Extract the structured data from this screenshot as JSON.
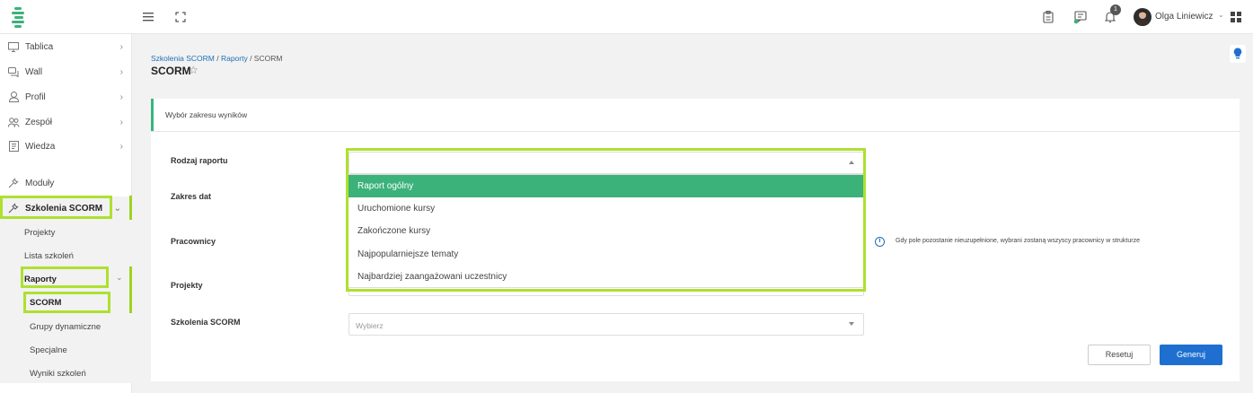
{
  "header": {
    "user_name": "Olga Liniewicz",
    "notification_count": "1"
  },
  "sidebar": {
    "items": [
      {
        "label": "Tablica"
      },
      {
        "label": "Wall"
      },
      {
        "label": "Profil"
      },
      {
        "label": "Zespół"
      },
      {
        "label": "Wiedza"
      },
      {
        "label": "Moduły"
      },
      {
        "label": "Szkolenia SCORM"
      }
    ],
    "sub_items": [
      {
        "label": "Projekty"
      },
      {
        "label": "Lista szkoleń"
      },
      {
        "label": "Raporty"
      }
    ],
    "report_items": [
      {
        "label": "SCORM"
      },
      {
        "label": "Grupy dynamiczne"
      },
      {
        "label": "Specjalne"
      },
      {
        "label": "Wyniki szkoleń"
      }
    ]
  },
  "breadcrumb": {
    "part1": "Szkolenia SCORM",
    "sep1": " / ",
    "part2": "Raporty",
    "sep2": " / SCORM"
  },
  "page_title": "SCORM",
  "card": {
    "header": "Wybór zakresu wyników",
    "fields": {
      "report_type": "Rodzaj raportu",
      "date_range": "Zakres dat",
      "employees": "Pracownicy",
      "projects": "Projekty",
      "scorm_trainings": "Szkolenia SCORM"
    },
    "scorm_placeholder": "Wybierz",
    "info_text": "Gdy pole pozostanie nieuzupełnione, wybrani zostaną wszyscy pracownicy w strukturze",
    "dropdown_options": [
      {
        "label": "Raport ogólny"
      },
      {
        "label": "Uruchomione kursy"
      },
      {
        "label": "Zakończone kursy"
      },
      {
        "label": "Najpopularniejsze tematy"
      },
      {
        "label": "Najbardziej zaangażowani uczestnicy"
      }
    ],
    "buttons": {
      "reset": "Resetuj",
      "generate": "Generuj"
    }
  },
  "colors": {
    "accent_green": "#3bb27a",
    "highlight": "#aee030",
    "primary_blue": "#1f6fd0"
  }
}
